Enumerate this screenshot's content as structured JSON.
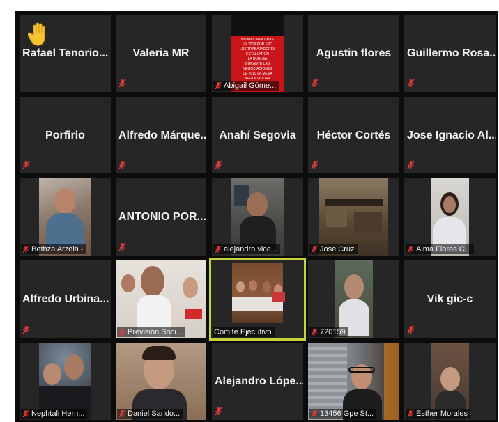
{
  "participants": [
    {
      "name": "Rafael  Tenorio...",
      "label": "",
      "hand_raised": true
    },
    {
      "name": "Valeria MR",
      "label": ""
    },
    {
      "name": "",
      "label": "Abigail Góme...",
      "screen_text": [
        "NO MAS MENTIRAS",
        "EN 2019 POR ESO",
        "LOS TRABAJADORES ESTALLARON",
        "LA HUELGA",
        "DURANTE LAS NEGOCIACIONES",
        "DE 2019 LA MESA NEGOCIADORA",
        "..."
      ]
    },
    {
      "name": "Agustin flores",
      "label": ""
    },
    {
      "name": "Guillermo  Rosa...",
      "label": ""
    },
    {
      "name": "Porfirio",
      "label": ""
    },
    {
      "name": "Alfredo  Márque...",
      "label": ""
    },
    {
      "name": "Anahí Segovia",
      "label": ""
    },
    {
      "name": "Héctor Cortés",
      "label": ""
    },
    {
      "name": "Jose Ignacio  Al...",
      "label": ""
    },
    {
      "name": "",
      "label": "Bethza Arzola -"
    },
    {
      "name": "ANTONIO  POR...",
      "label": ""
    },
    {
      "name": "",
      "label": "alejandro vice..."
    },
    {
      "name": "",
      "label": "Jose Cruz"
    },
    {
      "name": "",
      "label": "Alma Flores C..."
    },
    {
      "name": "Alfredo  Urbina...",
      "label": ""
    },
    {
      "name": "",
      "label": "Prevision Soci..."
    },
    {
      "name": "",
      "label": "Comité Ejecutivo",
      "active_speaker": true
    },
    {
      "name": "",
      "label": "720159"
    },
    {
      "name": "Vik gic-c",
      "label": ""
    },
    {
      "name": "",
      "label": "Nephtali Hern..."
    },
    {
      "name": "",
      "label": "Daniel Sando..."
    },
    {
      "name": "Alejandro  Lópe...",
      "label": ""
    },
    {
      "name": "",
      "label": "13456 Gpe St..."
    },
    {
      "name": "",
      "label": "Esther Morales"
    }
  ],
  "colors": {
    "tile_bg": "#262626",
    "active_border": "#c7d33a",
    "mute_icon": "#e0393b",
    "hand_icon": "#f5c430"
  }
}
